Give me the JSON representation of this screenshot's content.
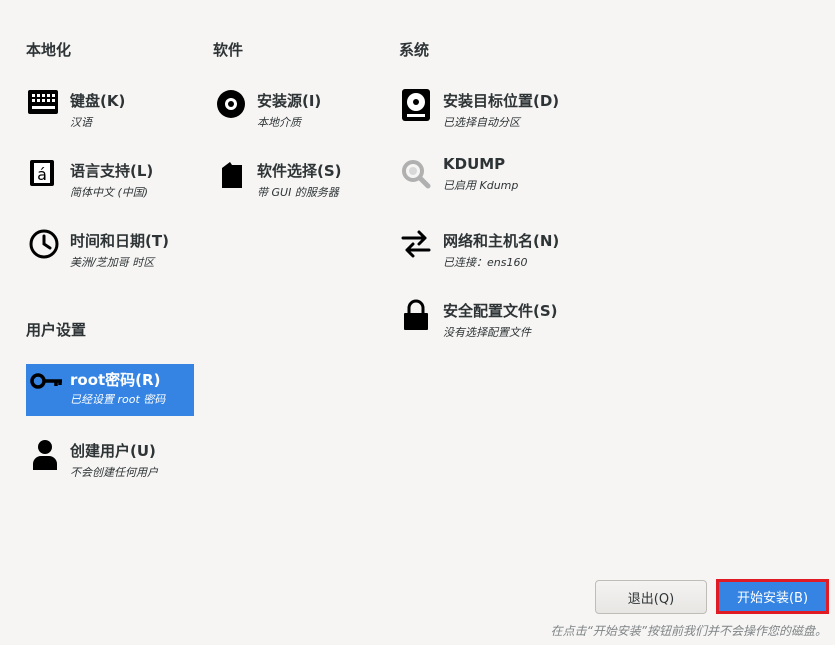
{
  "sections": {
    "localization": "本地化",
    "software": "软件",
    "system": "系统",
    "user_settings": "用户设置"
  },
  "spokes": {
    "keyboard": {
      "label": "键盘(K)",
      "status": "汉语",
      "icon": "keyboard-icon"
    },
    "language": {
      "label": "语言支持(L)",
      "status": "简体中文 (中国)",
      "icon": "language-icon"
    },
    "datetime": {
      "label": "时间和日期(T)",
      "status": "美洲/芝加哥 时区",
      "icon": "clock-icon"
    },
    "source": {
      "label": "安装源(I)",
      "status": "本地介质",
      "icon": "disc-icon"
    },
    "software_selection": {
      "label": "软件选择(S)",
      "status": "带 GUI 的服务器",
      "icon": "package-icon"
    },
    "destination": {
      "label": "安装目标位置(D)",
      "status": "已选择自动分区",
      "icon": "harddisk-icon"
    },
    "kdump": {
      "label": "KDUMP",
      "status": "已启用 Kdump",
      "icon": "magnifier-icon"
    },
    "network": {
      "label": "网络和主机名(N)",
      "status": "已连接：ens160",
      "icon": "network-arrows-icon"
    },
    "security": {
      "label": "安全配置文件(S)",
      "status": "没有选择配置文件",
      "icon": "lock-icon"
    },
    "root_password": {
      "label": "root密码(R)",
      "status": "已经设置 root 密码",
      "icon": "key-icon"
    },
    "create_user": {
      "label": "创建用户(U)",
      "status": "不会创建任何用户",
      "icon": "user-icon"
    }
  },
  "buttons": {
    "quit": "退出(Q)",
    "begin_install": "开始安装(B)"
  },
  "footer_note": "在点击“开始安装”按钮前我们并不会操作您的磁盘。",
  "colors": {
    "accent": "#3584e4",
    "highlight_border": "#e01b24",
    "background": "#f6f5f4"
  }
}
